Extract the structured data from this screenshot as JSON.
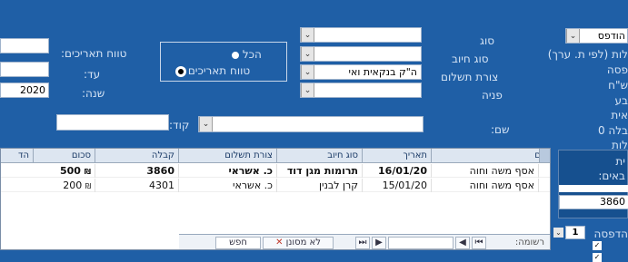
{
  "filters": {
    "type_label": "סוג",
    "charge_type_label": "סוג חיוב",
    "payment_method_label": "צורת תשלום",
    "payment_method_value": "ה\"ק בנקאית ואי",
    "referral_label": "פניה",
    "name_label": "שם:",
    "code_label": "קוד:",
    "date_range_label": "טווח תאריכים:",
    "to_label": "עד:",
    "year_label": "שנה:",
    "year_value": "2020",
    "radio_all": "הכל",
    "radio_range": "טווח תאריכים"
  },
  "sidebar": {
    "print_label": "הודפס",
    "items": [
      "לות (לפי ת. ערך)",
      "פסה",
      "ש\"ח",
      "בע",
      "אית",
      "בלה 0",
      "לות"
    ],
    "summary_labels": [
      "ית",
      "באים:"
    ],
    "summary_value": "3860",
    "bottom_label": "הדפסה",
    "bottom_value": "1"
  },
  "table": {
    "columns": [
      "שם",
      "תאריך",
      "סוג חיוב",
      "צורת תשלום",
      "קבלה",
      "סכום",
      "הד"
    ],
    "rows": [
      {
        "name": "אסף משה וחוה",
        "date": "16/01/20",
        "charge_type": "תרומות מגן דוד",
        "payment": "כ. אשראי",
        "receipt": "3860",
        "amount": "500"
      },
      {
        "name": "אסף משה וחוה",
        "date": "15/01/20",
        "charge_type": "קרן לבנין",
        "payment": "כ. אשראי",
        "receipt": "4301",
        "amount": "200"
      }
    ]
  },
  "navigator": {
    "record_label": "רשומה:",
    "filter_label": "לא מסונן",
    "search_label": "חפש"
  },
  "colors": {
    "background": "#1f5fa6",
    "label": "#d6e4f5",
    "grid_header": "#dde6f1"
  }
}
